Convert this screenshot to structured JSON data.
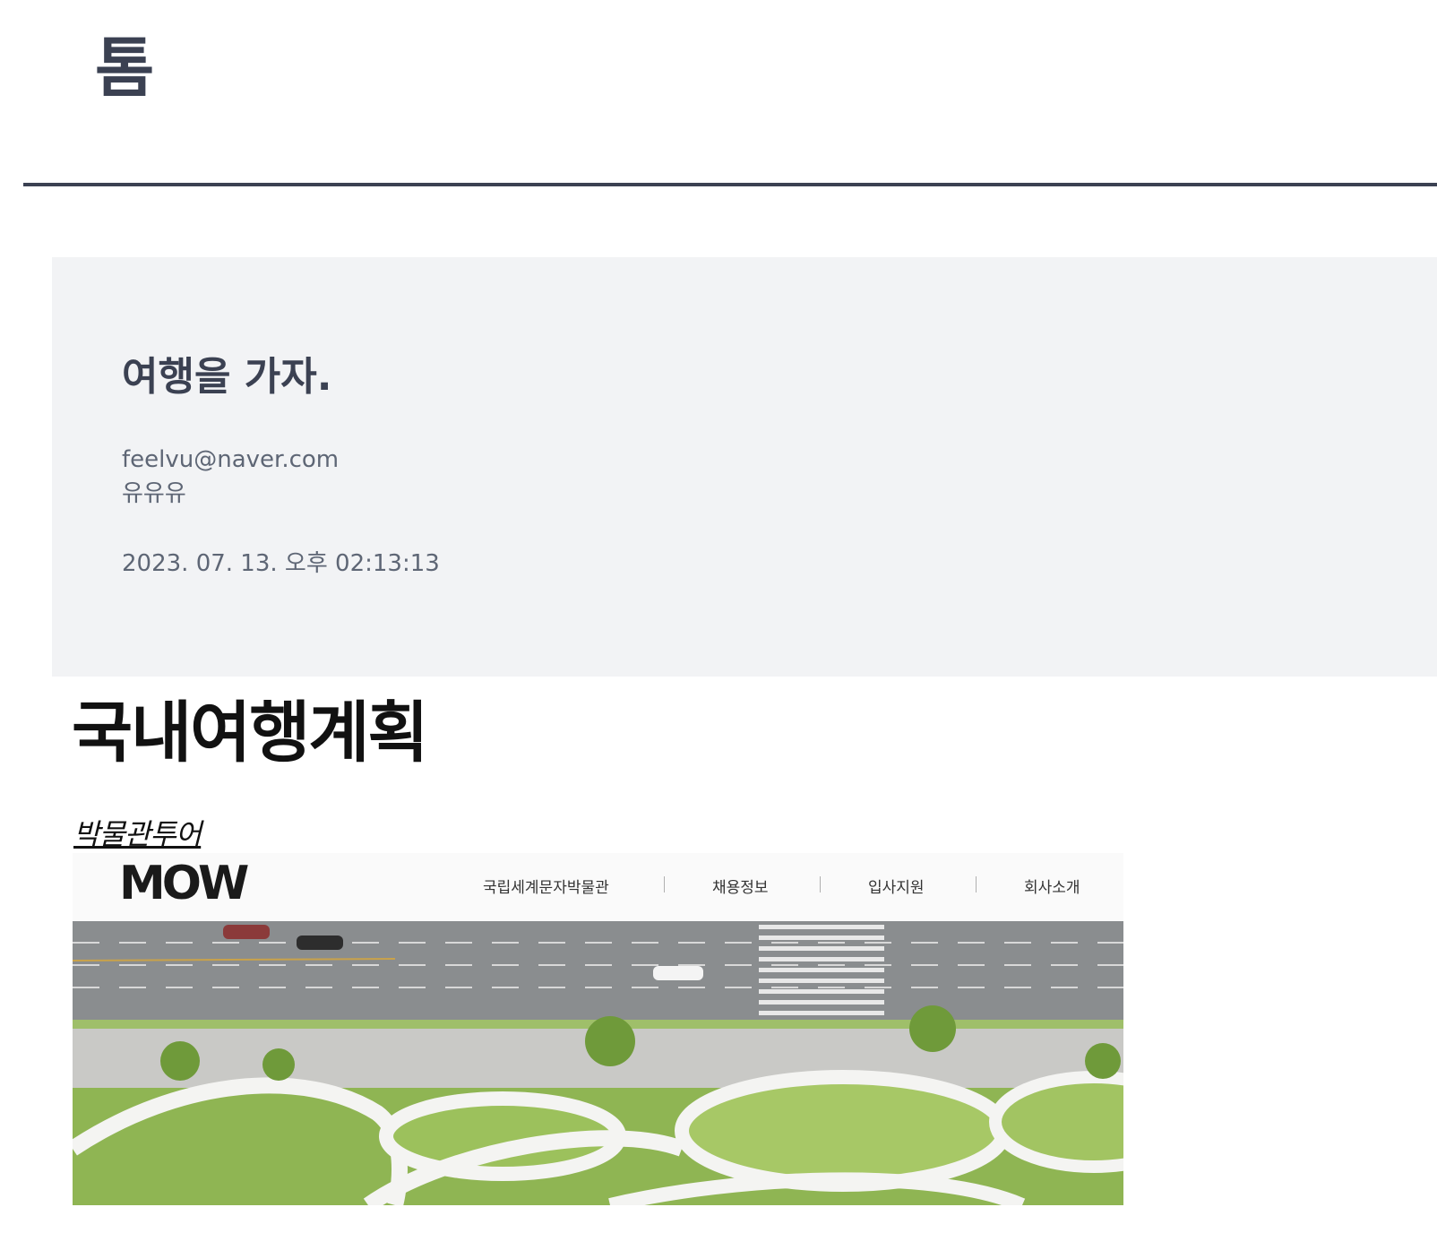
{
  "header": {
    "logo": "톰"
  },
  "post": {
    "title": "여행을 가자.",
    "email": "feelvu@naver.com",
    "author": "유유유",
    "date": "2023. 07. 13. 오후 02:13:13"
  },
  "content": {
    "heading": "국내여행계획",
    "link_label": "박물관투어",
    "image": {
      "logo_text": "MOW",
      "nav": [
        "국립세계문자박물관",
        "채용정보",
        "입사지원",
        "회사소개"
      ]
    }
  }
}
